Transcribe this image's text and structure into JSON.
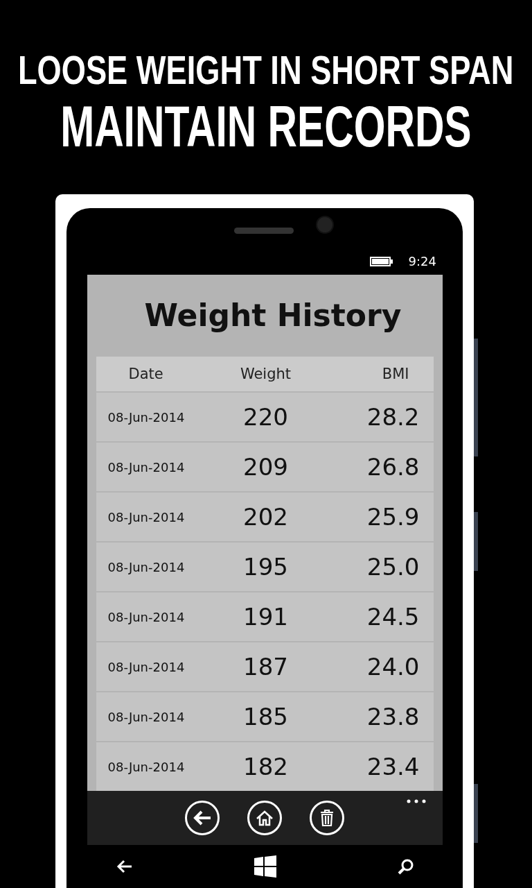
{
  "headline": [
    "LOOSE WEIGHT IN SHORT SPAN",
    "MAINTAIN RECORDS"
  ],
  "status_bar": {
    "time": "9:24"
  },
  "title": "Weight History",
  "table": {
    "columns": [
      "Date",
      "Weight",
      "BMI"
    ],
    "rows": [
      {
        "date": "08-Jun-2014",
        "weight": "220",
        "bmi": "28.2"
      },
      {
        "date": "08-Jun-2014",
        "weight": "209",
        "bmi": "26.8"
      },
      {
        "date": "08-Jun-2014",
        "weight": "202",
        "bmi": "25.9"
      },
      {
        "date": "08-Jun-2014",
        "weight": "195",
        "bmi": "25.0"
      },
      {
        "date": "08-Jun-2014",
        "weight": "191",
        "bmi": "24.5"
      },
      {
        "date": "08-Jun-2014",
        "weight": "187",
        "bmi": "24.0"
      },
      {
        "date": "08-Jun-2014",
        "weight": "185",
        "bmi": "23.8"
      },
      {
        "date": "08-Jun-2014",
        "weight": "182",
        "bmi": "23.4"
      }
    ]
  },
  "app_bar": {
    "buttons": [
      {
        "kind": "back"
      },
      {
        "kind": "home"
      },
      {
        "kind": "delete"
      }
    ]
  }
}
